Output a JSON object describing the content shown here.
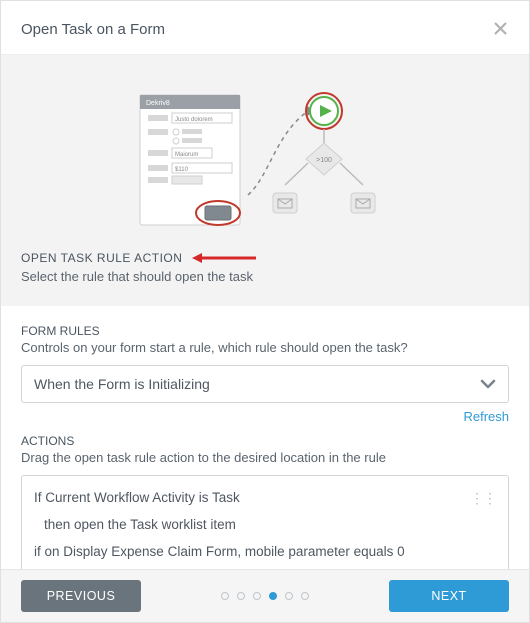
{
  "header": {
    "title": "Open Task on a Form"
  },
  "illustration": {
    "form_title": "Dekriv8",
    "field1": "Justo dolorem",
    "field2": "Maiorum",
    "field3": "$110",
    "diamond": ">100"
  },
  "intro": {
    "section_title": "OPEN TASK RULE ACTION",
    "section_desc": "Select the rule that should open the task"
  },
  "form_rules": {
    "label": "FORM RULES",
    "helper": "Controls on your form start a rule, which rule should open the task?",
    "selected": "When the Form is Initializing",
    "refresh": "Refresh"
  },
  "actions": {
    "label": "ACTIONS",
    "helper": "Drag the open task rule action to the desired location in the rule",
    "line1": "If Current Workflow Activity is Task",
    "line2": "then open the Task worklist item",
    "line3": "if on Display Expense Claim Form, mobile parameter equals 0"
  },
  "footer": {
    "prev": "PREVIOUS",
    "next": "NEXT",
    "active_step": 3,
    "total_steps": 6
  }
}
